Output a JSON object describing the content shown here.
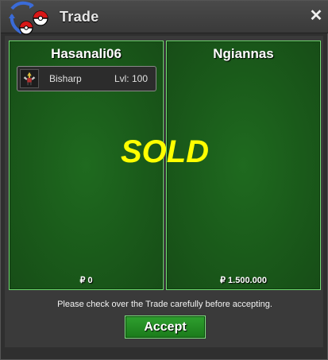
{
  "window": {
    "title": "Trade",
    "close_symbol": "✕"
  },
  "trade": {
    "left": {
      "player_name": "Hasanali06",
      "pokemon": [
        {
          "name": "Bisharp",
          "level": "Lvl: 100",
          "icon": "bisharp-sprite-icon"
        }
      ],
      "money_currency": "₽",
      "money": "0"
    },
    "right": {
      "player_name": "Ngiannas",
      "pokemon": [],
      "money_currency": "₽",
      "money": "1.500.000"
    }
  },
  "overlay": {
    "text": "SOLD"
  },
  "footer": {
    "notice": "Please check over the Trade carefully before accepting.",
    "accept_label": "Accept"
  },
  "colors": {
    "panel_green": "#1f6a1f",
    "panel_border": "#6fdc6f",
    "sold_yellow": "#ffff00",
    "accept_green": "#2fa02f"
  }
}
